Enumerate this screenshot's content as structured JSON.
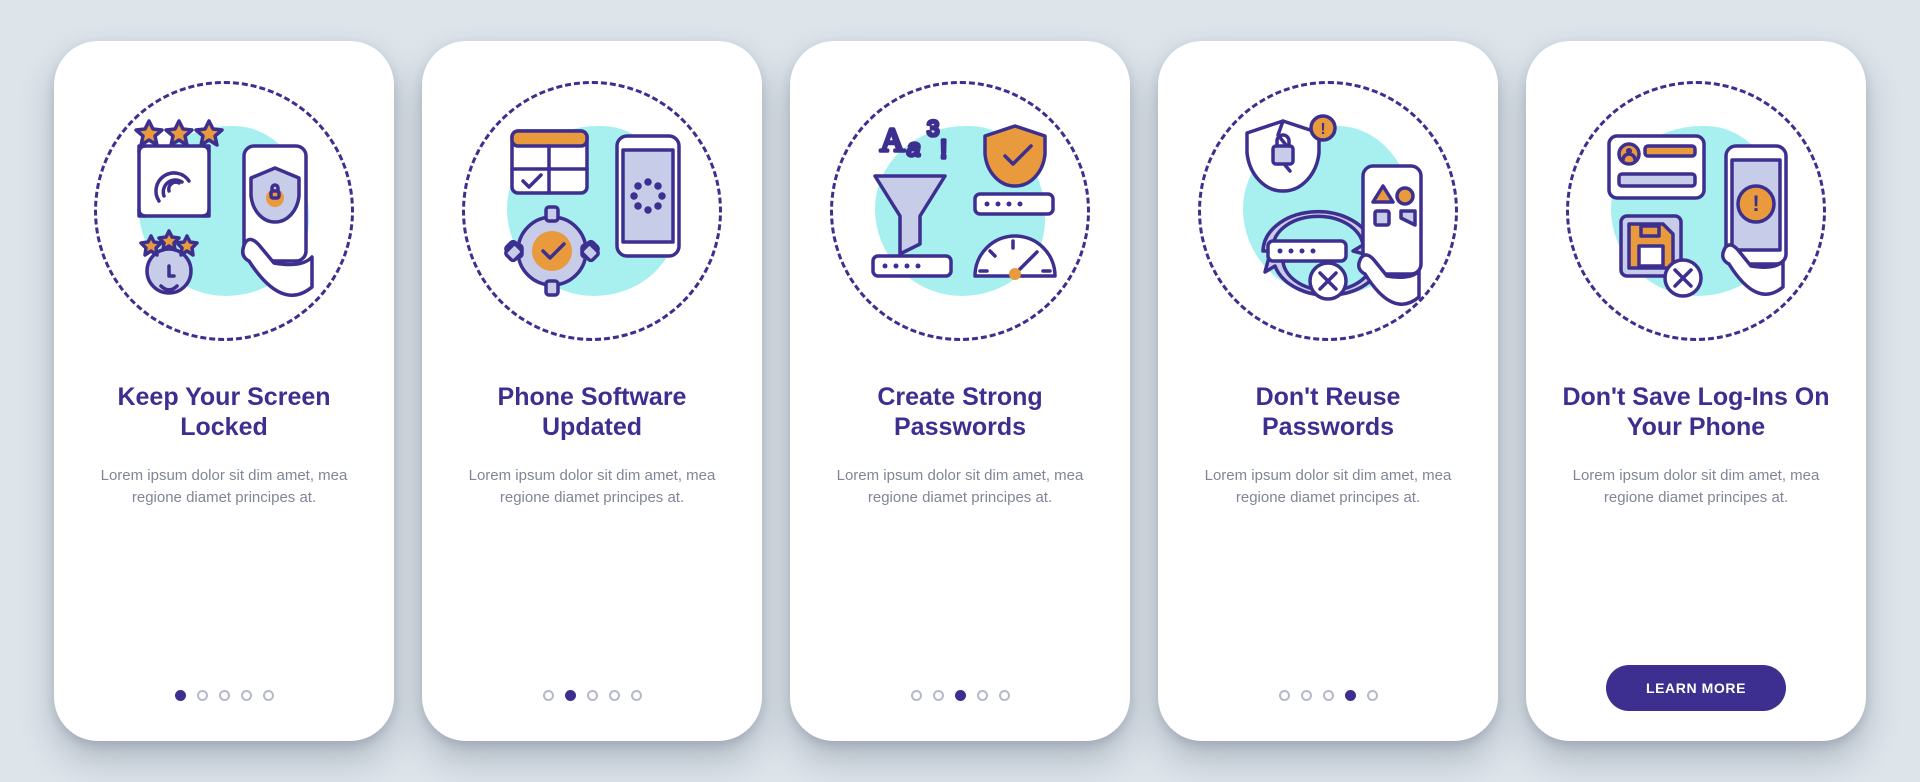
{
  "colors": {
    "primary": "#3d2f8f",
    "accent": "#e89a3c",
    "cyan": "#a8f0f0",
    "textMuted": "#808696",
    "bg": "#dde4ea"
  },
  "cta_label": "LEARN MORE",
  "common_body": "Lorem ipsum dolor sit dim amet, mea regione diamet principes at.",
  "slides": [
    {
      "title": "Keep Your Screen Locked",
      "icon": "screen-lock-icon",
      "has_cta": false,
      "active_dot": 0
    },
    {
      "title": "Phone Software Updated",
      "icon": "software-update-icon",
      "has_cta": false,
      "active_dot": 1
    },
    {
      "title": "Create Strong Passwords",
      "icon": "strong-password-icon",
      "has_cta": false,
      "active_dot": 2
    },
    {
      "title": "Don't Reuse Passwords",
      "icon": "no-reuse-icon",
      "has_cta": false,
      "active_dot": 3
    },
    {
      "title": "Don't Save Log-Ins On Your Phone",
      "icon": "no-save-login-icon",
      "has_cta": true,
      "active_dot": 4
    }
  ],
  "dot_count": 5
}
